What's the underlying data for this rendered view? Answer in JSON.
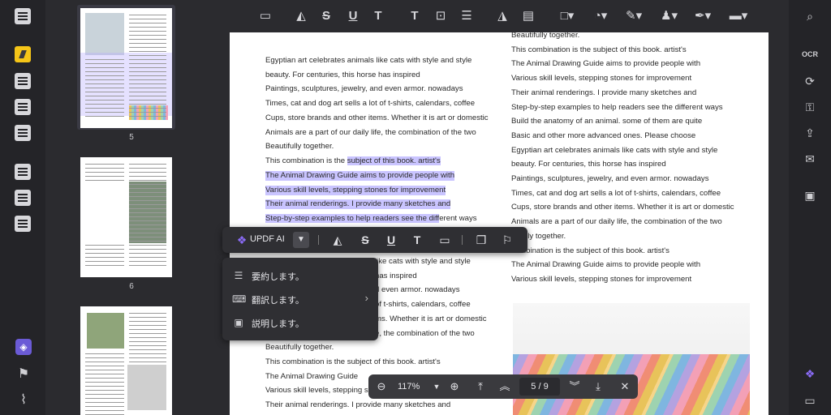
{
  "colors": {
    "accent": "#f5c518",
    "highlight": "#c9c4ff",
    "background": "#2b2b2f"
  },
  "toolbar": {
    "icons": [
      "comment-icon",
      "highlighter-icon",
      "strikethrough-icon",
      "underline-icon",
      "squiggly-underline-icon",
      "text-icon",
      "textbox-icon",
      "text-callout-icon",
      "area-highlight-icon",
      "eraser-icon",
      "shape-icon",
      "sticker-icon",
      "pencil-icon",
      "stamp-icon",
      "signature-icon",
      "measure-icon"
    ]
  },
  "thumbnails": {
    "items": [
      {
        "label": "5"
      },
      {
        "label": "6"
      }
    ]
  },
  "document": {
    "left_lines": [
      "Egyptian art celebrates animals like cats with style and style",
      "beauty. For centuries, this horse has inspired",
      "Paintings, sculptures, jewelry, and even armor. nowadays",
      "Times, cat and dog art sells a lot of t-shirts, calendars, coffee",
      "Cups, store brands and other items. Whether it is art or domestic",
      "Animals are a part of our daily life, the combination of the two",
      "Beautifully together."
    ],
    "sel_line1_prefix": "This combination is the ",
    "sel_line1_hl": "subject of this book. artist's",
    "sel_line2": "The Animal Drawing Guide aims to provide people with",
    "sel_line3": "Various skill levels, stepping stones for improvement",
    "sel_line4": "Their animal renderings. I provide many sketches and",
    "sel_line5_hl": "Step-by-step examples to help readers see the diff",
    "sel_line5_rest": "erent ways",
    "left_lower_lines": [
      "like cats with style and style",
      "has inspired",
      "d even armor. nowadays",
      "of t-shirts, calendars, coffee",
      "ms. Whether it is art or domestic",
      "e, the combination of the two",
      "Beautifully together.",
      "This combination is the subject of this book. artist's",
      "The Animal Drawing Guide",
      "Various skill levels, stepping s",
      "Their animal renderings. I provide many sketches and"
    ],
    "right_lines": [
      "Beautifully together.",
      "This combination is the subject of this book. artist's",
      "The Animal Drawing Guide aims to provide people with",
      "Various skill levels, stepping stones for improvement",
      "Their animal renderings. I provide many sketches and",
      "Step-by-step examples to help readers see the different ways",
      "Build the anatomy of an animal. some of them are quite",
      "Basic and other more advanced ones. Please choose",
      "Egyptian art celebrates animals like cats with style and style",
      "beauty. For centuries, this horse has inspired",
      "Paintings, sculptures, jewelry, and even armor. nowadays",
      "Times, cat and dog art sells a lot of t-shirts, calendars, coffee",
      "Cups, store brands and other items. Whether it is art or domestic",
      "Animals are a part of our daily life, the combination of the two",
      "utifully together.",
      "combination is the subject of this book. artist's",
      "The Animal Drawing Guide aims to provide people with",
      "Various skill levels, stepping stones for improvement"
    ]
  },
  "selection_toolbar": {
    "ai_label": "UPDF AI"
  },
  "ai_menu": {
    "items": [
      {
        "label": "要約します。",
        "icon": "list-icon"
      },
      {
        "label": "翻訳します。",
        "icon": "translate-icon",
        "has_submenu": true
      },
      {
        "label": "説明します。",
        "icon": "explain-icon"
      }
    ]
  },
  "zoombar": {
    "zoom": "117%",
    "page_current": "5",
    "page_sep": "/",
    "page_total": "9"
  }
}
